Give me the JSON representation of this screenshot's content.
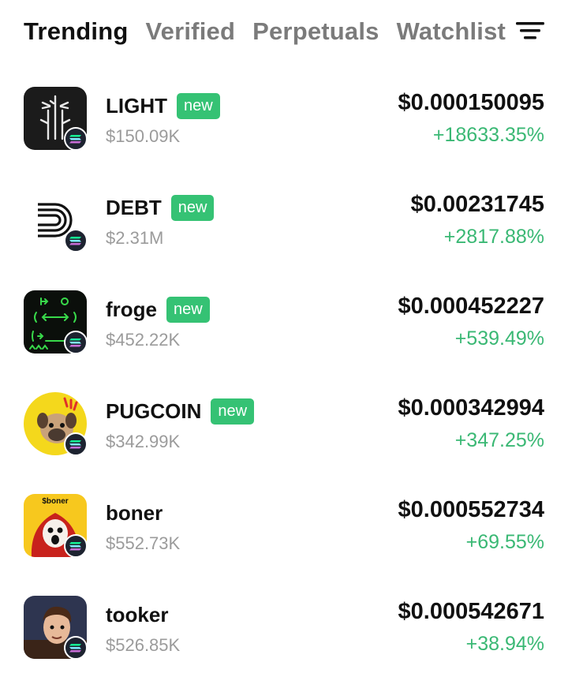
{
  "tabs": [
    {
      "label": "Trending",
      "active": true
    },
    {
      "label": "Verified",
      "active": false
    },
    {
      "label": "Perpetuals",
      "active": false
    },
    {
      "label": "Watchlist",
      "active": false
    }
  ],
  "filter_icon": "filter-lines-icon",
  "colors": {
    "positive": "#3ab874",
    "badge_bg": "#35c274",
    "muted": "#9b9b9b",
    "text": "#111111"
  },
  "tokens": [
    {
      "name": "LIGHT",
      "badge": "new",
      "market_cap": "$150.09K",
      "price": "$0.000150095",
      "change": "+18633.35%",
      "icon": "light-token-icon",
      "chain_icon": "solana-chain-icon"
    },
    {
      "name": "DEBT",
      "badge": "new",
      "market_cap": "$2.31M",
      "price": "$0.00231745",
      "change": "+2817.88%",
      "icon": "debt-token-icon",
      "chain_icon": "solana-chain-icon"
    },
    {
      "name": "froge",
      "badge": "new",
      "market_cap": "$452.22K",
      "price": "$0.000452227",
      "change": "+539.49%",
      "icon": "froge-token-icon",
      "chain_icon": "solana-chain-icon"
    },
    {
      "name": "PUGCOIN",
      "badge": "new",
      "market_cap": "$342.99K",
      "price": "$0.000342994",
      "change": "+347.25%",
      "icon": "pugcoin-token-icon",
      "chain_icon": "solana-chain-icon"
    },
    {
      "name": "boner",
      "badge": "",
      "market_cap": "$552.73K",
      "price": "$0.000552734",
      "change": "+69.55%",
      "icon": "boner-token-icon",
      "icon_text": "$boner",
      "chain_icon": "solana-chain-icon"
    },
    {
      "name": "tooker",
      "badge": "",
      "market_cap": "$526.85K",
      "price": "$0.000542671",
      "change": "+38.94%",
      "icon": "tooker-token-icon",
      "chain_icon": "solana-chain-icon"
    }
  ]
}
